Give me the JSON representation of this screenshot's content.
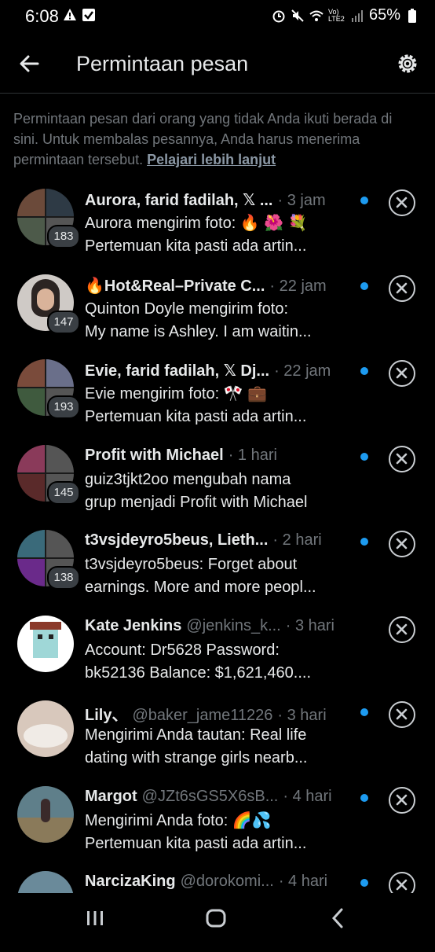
{
  "status": {
    "time": "6:08",
    "network_label": "Vo) LTE2",
    "battery": "65%"
  },
  "header": {
    "title": "Permintaan pesan"
  },
  "description": {
    "text": "Permintaan pesan dari orang yang tidak Anda ikuti berada di sini. Untuk membalas pesannya, Anda harus menerima permintaan tersebut.",
    "link": "Pelajari lebih lanjut"
  },
  "requests": [
    {
      "name": "Aurora, farid fadilah, 𝕏 ...",
      "handle": "",
      "time": "· 3 jam",
      "line1": "Aurora mengirim foto: 🔥 🌺 💐",
      "line2": "Pertemuan kita pasti ada artin...",
      "count": "183",
      "unread": true
    },
    {
      "name": "🔥Hot&Real–Private C...",
      "handle": "",
      "time": "· 22 jam",
      "line1": "Quinton Doyle mengirim foto:",
      "line2": "My name is Ashley. I am waitin...",
      "count": "147",
      "unread": true
    },
    {
      "name": "Evie, farid fadilah, 𝕏 Dj...",
      "handle": "",
      "time": "· 22 jam",
      "line1": "Evie mengirim foto: 🎌 💼",
      "line2": "Pertemuan kita pasti ada artin...",
      "count": "193",
      "unread": true
    },
    {
      "name": "Profit with Michael",
      "handle": "",
      "time": "· 1 hari",
      "line1": "guiz3tjkt2oo mengubah nama",
      "line2": "grup menjadi Profit with Michael",
      "count": "145",
      "unread": true
    },
    {
      "name": "t3vsjdeyro5beus, Lieth...",
      "handle": "",
      "time": "· 2 hari",
      "line1": "t3vsjdeyro5beus: Forget about",
      "line2": "earnings. More and more peopl...",
      "count": "138",
      "unread": true
    },
    {
      "name": "Kate Jenkins",
      "handle": "@jenkins_k...",
      "time": "· 3 hari",
      "line1": "Account: Dr5628 Password:",
      "line2": "bk52136  Balance: $1,621,460....",
      "count": "",
      "unread": false
    },
    {
      "name": "Lily、",
      "handle": "@baker_jame11226",
      "time": "· 3 hari",
      "line1": "Mengirimi Anda tautan: Real life",
      "line2": "dating with strange girls nearb...",
      "count": "",
      "unread": true
    },
    {
      "name": "Margot",
      "handle": "@JZt6sGS5X6sB...",
      "time": "· 4 hari",
      "line1": "Mengirimi Anda foto: 🌈💦",
      "line2": "Pertemuan kita pasti ada artin...",
      "count": "",
      "unread": true
    },
    {
      "name": "NarcizaKing",
      "handle": "@dorokomi...",
      "time": "· 4 hari",
      "line1": "",
      "line2": "",
      "count": "",
      "unread": true
    }
  ],
  "colors": {
    "accent": "#1d9bf0",
    "background": "#000000",
    "secondary_text": "#71767b"
  },
  "icons": {
    "back": "arrow-left-icon",
    "settings": "gear-icon",
    "dismiss": "close-circle-icon"
  }
}
